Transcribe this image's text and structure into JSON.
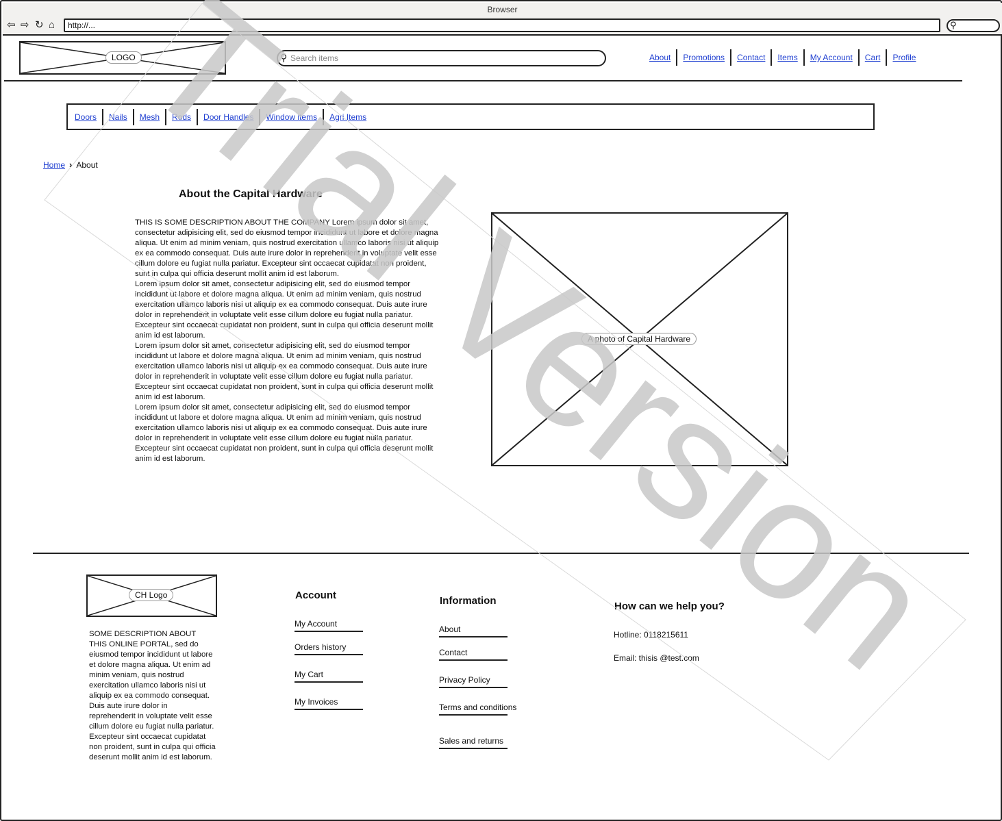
{
  "browser": {
    "title": "Browser",
    "url": "http://..."
  },
  "header": {
    "logo_label": "LOGO",
    "search_placeholder": "Search items",
    "nav": [
      "About",
      "Promotions",
      "Contact",
      "Items",
      "My Account",
      "Cart",
      "Profile"
    ]
  },
  "categories": [
    "Doors",
    "Nails",
    "Mesh",
    "Rods",
    "Door Handles",
    "Window items",
    "Agri Items"
  ],
  "breadcrumb": {
    "home": "Home",
    "current": "About"
  },
  "about": {
    "title": "About the Capital Hardware",
    "paragraphs": [
      "THIS IS SOME DESCRIPTION ABOUT THE COMPANY Lorem ipsum dolor sit amet, consectetur adipisicing elit, sed do eiusmod tempor incididunt ut labore et dolore magna aliqua. Ut enim ad minim veniam, quis nostrud exercitation ullamco laboris nisi ut aliquip ex ea commodo consequat. Duis aute irure dolor in reprehenderit in voluptate velit esse cillum dolore eu fugiat nulla pariatur. Excepteur sint occaecat cupidatat non proident, sunt in culpa qui officia deserunt mollit anim id est laborum.",
      "Lorem ipsum dolor sit amet, consectetur adipisicing elit, sed do eiusmod tempor incididunt ut labore et dolore magna aliqua. Ut enim ad minim veniam, quis nostrud exercitation ullamco laboris nisi ut aliquip ex ea commodo consequat. Duis aute irure dolor in reprehenderit in voluptate velit esse cillum dolore eu fugiat nulla pariatur. Excepteur sint occaecat cupidatat non proident, sunt in culpa qui officia deserunt mollit anim id est laborum.",
      "Lorem ipsum dolor sit amet, consectetur adipisicing elit, sed do eiusmod tempor incididunt ut labore et dolore magna aliqua. Ut enim ad minim veniam, quis nostrud exercitation ullamco laboris nisi ut aliquip ex ea commodo consequat. Duis aute irure dolor in reprehenderit in voluptate velit esse cillum dolore eu fugiat nulla pariatur. Excepteur sint occaecat cupidatat non proident, sunt in culpa qui officia deserunt mollit anim id est laborum.",
      "Lorem ipsum dolor sit amet, consectetur adipisicing elit, sed do eiusmod tempor incididunt ut labore et dolore magna aliqua. Ut enim ad minim veniam, quis nostrud exercitation ullamco laboris nisi ut aliquip ex ea commodo consequat. Duis aute irure dolor in reprehenderit in voluptate velit esse cillum dolore eu fugiat nulla pariatur. Excepteur sint occaecat cupidatat non proident, sunt in culpa qui officia deserunt mollit anim id est laborum."
    ],
    "photo_label": "A photo of Capital Hardware"
  },
  "footer": {
    "logo_label": "CH Logo",
    "description": "SOME DESCRIPTION ABOUT THIS ONLINE PORTAL, sed do eiusmod tempor incididunt ut labore et dolore magna aliqua. Ut enim ad minim veniam, quis nostrud exercitation ullamco laboris nisi ut aliquip ex ea commodo consequat. Duis aute irure dolor in reprehenderit in voluptate velit esse cillum dolore eu fugiat nulla pariatur. Excepteur sint occaecat cupidatat non proident, sunt in culpa qui officia deserunt mollit anim id est laborum.",
    "account": {
      "title": "Account",
      "links": [
        "My Account",
        "Orders history",
        "My Cart",
        "My Invoices"
      ]
    },
    "information": {
      "title": "Information",
      "links": [
        "About",
        "Contact",
        "Privacy Policy",
        "Terms and conditions",
        "Sales and returns"
      ]
    },
    "help": {
      "title": "How can we help you?",
      "hotline": "Hotline: 0118215611",
      "email": "Email: thisis @test.com"
    }
  },
  "watermark": "Trial Version",
  "colors": {
    "link": "#1f3fd1",
    "chrome": "#f2f1ef",
    "watermark": "#c8c8c8"
  }
}
